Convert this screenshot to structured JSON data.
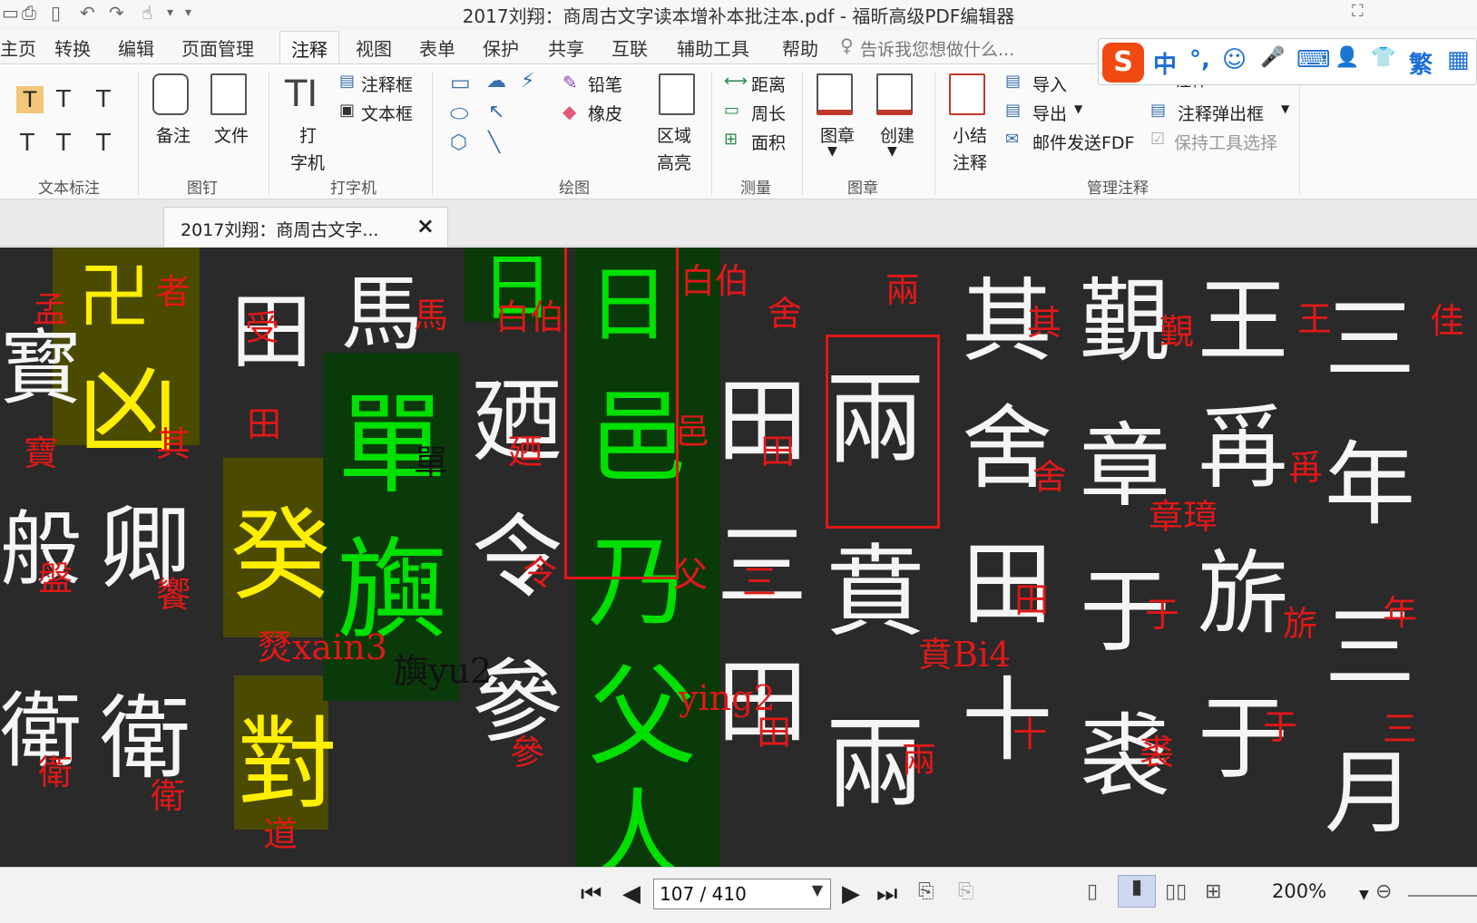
{
  "window": {
    "title": "2017刘翔：商周古文字读本增补本批注本.pdf - 福昕高级PDF编辑器"
  },
  "menu": {
    "items": [
      "主页",
      "转换",
      "编辑",
      "页面管理",
      "注释",
      "视图",
      "表单",
      "保护",
      "共享",
      "互联",
      "辅助工具",
      "帮助"
    ],
    "active": "注释",
    "tell_me": "告诉我您想做什么..."
  },
  "ribbon": {
    "groups": {
      "text_markup": "文本标注",
      "pin": "图钉",
      "typewriter": "打字机",
      "drawing": "绘图",
      "measure": "测量",
      "stamp": "图章",
      "manage": "管理注释"
    },
    "pin": {
      "note": "备注",
      "file": "文件"
    },
    "typewriter": {
      "type_top": "打",
      "type_bottom": "字机",
      "callout": "注释框",
      "textbox": "文本框"
    },
    "drawing": {
      "pencil": "铅笔",
      "eraser": "橡皮",
      "area_hl_top": "区域",
      "area_hl_bottom": "高亮"
    },
    "measure": {
      "distance": "距离",
      "perimeter": "周长",
      "area": "面积"
    },
    "stamp": {
      "stamp": "图章",
      "create": "创建"
    },
    "manage": {
      "summary_top": "小结",
      "summary_bottom": "注释",
      "import": "导入",
      "export": "导出",
      "email": "邮件发送FDF",
      "annot_top": "注释",
      "popup": "注释弹出框",
      "keep_tool": "保持工具选择"
    }
  },
  "ime": {
    "logo": "S",
    "items": [
      "中",
      "°,",
      "☺",
      "🎤",
      "⌨",
      "👤",
      "👕",
      "繁",
      "▦"
    ]
  },
  "doc_tab": {
    "label": "2017刘翔：商周古文字..."
  },
  "document": {
    "annotations": [
      "孟",
      "者",
      "受",
      "馬",
      "白伯",
      "白伯",
      "舍",
      "兩",
      "其",
      "覲",
      "王",
      "佳",
      "寶",
      "其",
      "田",
      "單",
      "廼",
      "邑",
      "田",
      "舍",
      "爯",
      "章璋",
      "盤",
      "饗",
      "令",
      "父",
      "三",
      "田",
      "于",
      "旂",
      "年",
      "燹xain3",
      "旟yu2",
      "ying2",
      "賁Bi4",
      "衛",
      "衛",
      "參",
      "田",
      "兩",
      "十",
      "裘",
      "于",
      "三",
      "道"
    ]
  },
  "statusbar": {
    "page": "107 / 410",
    "zoom": "200%"
  },
  "colors": {
    "annotation_red": "#e01818",
    "highlight_yellow": "#ffee00",
    "highlight_green": "#00e000",
    "ime_orange": "#f04a12"
  }
}
